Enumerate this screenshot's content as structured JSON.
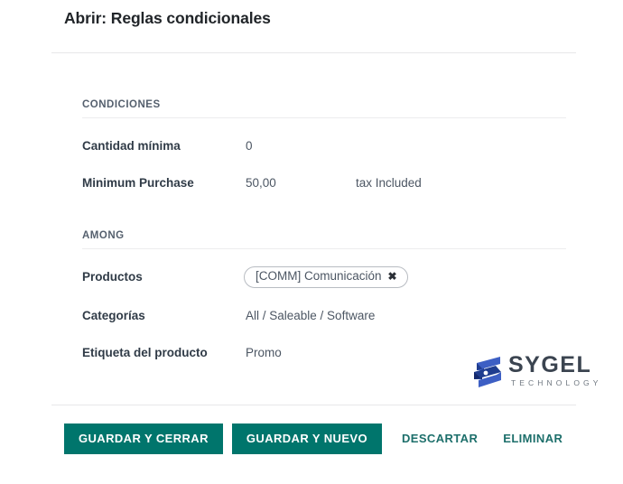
{
  "dialog": {
    "title": "Abrir: Reglas condicionales"
  },
  "sections": [
    {
      "id": "conditions",
      "title": "CONDICIONES",
      "fields": [
        {
          "label": "Cantidad mínima",
          "value": "0",
          "extra": ""
        },
        {
          "label": "Minimum Purchase",
          "value": "50,00",
          "extra": "tax Included"
        }
      ]
    },
    {
      "id": "among",
      "title": "AMONG",
      "fields": [
        {
          "label": "Productos",
          "value": "[COMM] Comunicación",
          "remove_icon": "✖"
        },
        {
          "label": "Categorías",
          "value": "All / Saleable / Software"
        },
        {
          "label": "Etiqueta del producto",
          "value": "Promo"
        }
      ]
    }
  ],
  "logo": {
    "word": "SYGEL",
    "sub": "TECHNOLOGY",
    "mark_color_dark": "#1f3d8f",
    "mark_color_light": "#3d5fc4"
  },
  "footer": {
    "save_close": "GUARDAR Y CERRAR",
    "save_new": "GUARDAR Y NUEVO",
    "discard": "DESCARTAR",
    "delete": "ELIMINAR"
  },
  "colors": {
    "primary": "#00756c",
    "link": "#1d6f6b",
    "label": "#303b47",
    "value": "#4c5663"
  }
}
